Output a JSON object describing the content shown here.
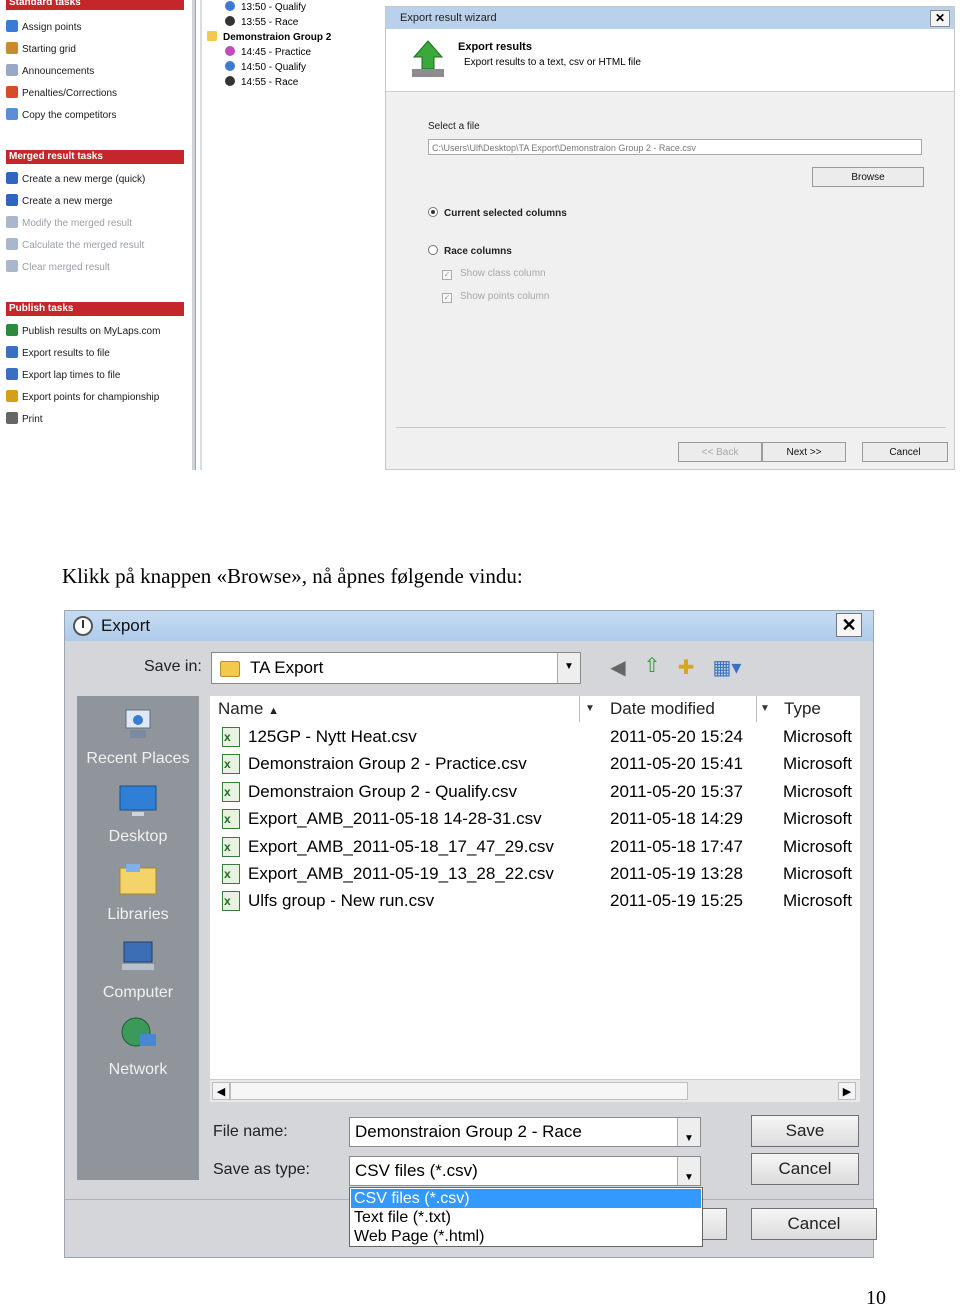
{
  "top_screenshot": {
    "tasks_partial_header": "Standard tasks",
    "tasks_top": [
      {
        "label": "Assign points",
        "icon": "assign-points-icon",
        "color": "#3b7bd6"
      },
      {
        "label": "Starting grid",
        "icon": "grid-icon",
        "color": "#c98a2b"
      },
      {
        "label": "Announcements",
        "icon": "announcement-icon",
        "color": "#9aa8c8"
      },
      {
        "label": "Penalties/Corrections",
        "icon": "penalty-icon",
        "color": "#d94a2b"
      },
      {
        "label": "Copy the competitors",
        "icon": "copy-icon",
        "color": "#5b8ed6"
      }
    ],
    "merged_header": "Merged result tasks",
    "merged_tasks": [
      {
        "label": "Create a new merge (quick)",
        "enabled": true
      },
      {
        "label": "Create a new merge",
        "enabled": true
      },
      {
        "label": "Modify the merged result",
        "enabled": false
      },
      {
        "label": "Calculate the merged result",
        "enabled": false
      },
      {
        "label": "Clear merged result",
        "enabled": false
      }
    ],
    "publish_header": "Publish tasks",
    "publish_tasks": [
      {
        "label": "Publish results on MyLaps.com",
        "icon": "globe-icon",
        "color": "#2b8a3b"
      },
      {
        "label": "Export results to file",
        "icon": "export-icon",
        "color": "#3b6fc4"
      },
      {
        "label": "Export lap times to file",
        "icon": "export-laps-icon",
        "color": "#3b6fc4"
      },
      {
        "label": "Export points for championship",
        "icon": "trophy-icon",
        "color": "#d4a017"
      },
      {
        "label": "Print",
        "icon": "print-icon",
        "color": "#666666"
      }
    ],
    "tree": [
      {
        "label": "13:50 - Qualify",
        "dot": "#3b7bd6",
        "indent": 1,
        "bold": false
      },
      {
        "label": "13:55 - Race",
        "dot": "#333333",
        "indent": 1,
        "bold": false
      },
      {
        "label": "Demonstraion Group 2",
        "dot": "folder",
        "indent": 0,
        "bold": true
      },
      {
        "label": "14:45 - Practice",
        "dot": "#c04bc0",
        "indent": 1,
        "bold": false
      },
      {
        "label": "14:50 - Qualify",
        "dot": "#3b7bd6",
        "indent": 1,
        "bold": false
      },
      {
        "label": "14:55 - Race",
        "dot": "#333333",
        "indent": 1,
        "bold": false
      }
    ],
    "wizard": {
      "title": "Export result wizard",
      "close": "✕",
      "head_title": "Export results",
      "head_sub": "Export results to a text, csv or HTML file",
      "select_label": "Select a file",
      "file_path": "C:\\Users\\Ulf\\Desktop\\TA Export\\Demonstraion Group 2 - Race.csv",
      "browse": "Browse",
      "radio_current": "Current selected columns",
      "radio_race": "Race columns",
      "cb_class": "Show class column",
      "cb_points": "Show points column",
      "back": "<< Back",
      "next": "Next >>",
      "cancel": "Cancel"
    }
  },
  "caption": "Klikk på knappen «Browse», nå åpnes følgende vindu:",
  "export_dialog": {
    "title": "Export",
    "close": "✕",
    "save_in_label": "Save in:",
    "save_in_value": "TA Export",
    "toolbar": [
      "back-icon",
      "up-folder-icon",
      "new-folder-icon",
      "view-menu-icon"
    ],
    "places": [
      {
        "label": "Recent Places",
        "icon": "recent-places-icon"
      },
      {
        "label": "Desktop",
        "icon": "desktop-icon"
      },
      {
        "label": "Libraries",
        "icon": "libraries-icon"
      },
      {
        "label": "Computer",
        "icon": "computer-icon"
      },
      {
        "label": "Network",
        "icon": "network-icon"
      }
    ],
    "columns": {
      "name": "Name",
      "date": "Date modified",
      "type": "Type"
    },
    "files": [
      {
        "name": "125GP - Nytt Heat.csv",
        "date": "2011-05-20 15:24",
        "type": "Microsoft"
      },
      {
        "name": "Demonstraion Group 2 - Practice.csv",
        "date": "2011-05-20 15:41",
        "type": "Microsoft"
      },
      {
        "name": "Demonstraion Group 2 - Qualify.csv",
        "date": "2011-05-20 15:37",
        "type": "Microsoft"
      },
      {
        "name": "Export_AMB_2011-05-18 14-28-31.csv",
        "date": "2011-05-18 14:29",
        "type": "Microsoft"
      },
      {
        "name": "Export_AMB_2011-05-18_17_47_29.csv",
        "date": "2011-05-18 17:47",
        "type": "Microsoft"
      },
      {
        "name": "Export_AMB_2011-05-19_13_28_22.csv",
        "date": "2011-05-19 13:28",
        "type": "Microsoft"
      },
      {
        "name": "Ulfs group - New run.csv",
        "date": "2011-05-19 15:25",
        "type": "Microsoft"
      }
    ],
    "file_name_label": "File name:",
    "file_name_value": "Demonstraion Group 2 - Race",
    "save_type_label": "Save as type:",
    "save_type_value": "CSV files (*.csv)",
    "save_type_options": [
      "CSV files (*.csv)",
      "Text file (*.txt)",
      "Web Page (*.html)"
    ],
    "save": "Save",
    "cancel": "Cancel",
    "cancel_back": "Cancel"
  },
  "page_number": "10"
}
